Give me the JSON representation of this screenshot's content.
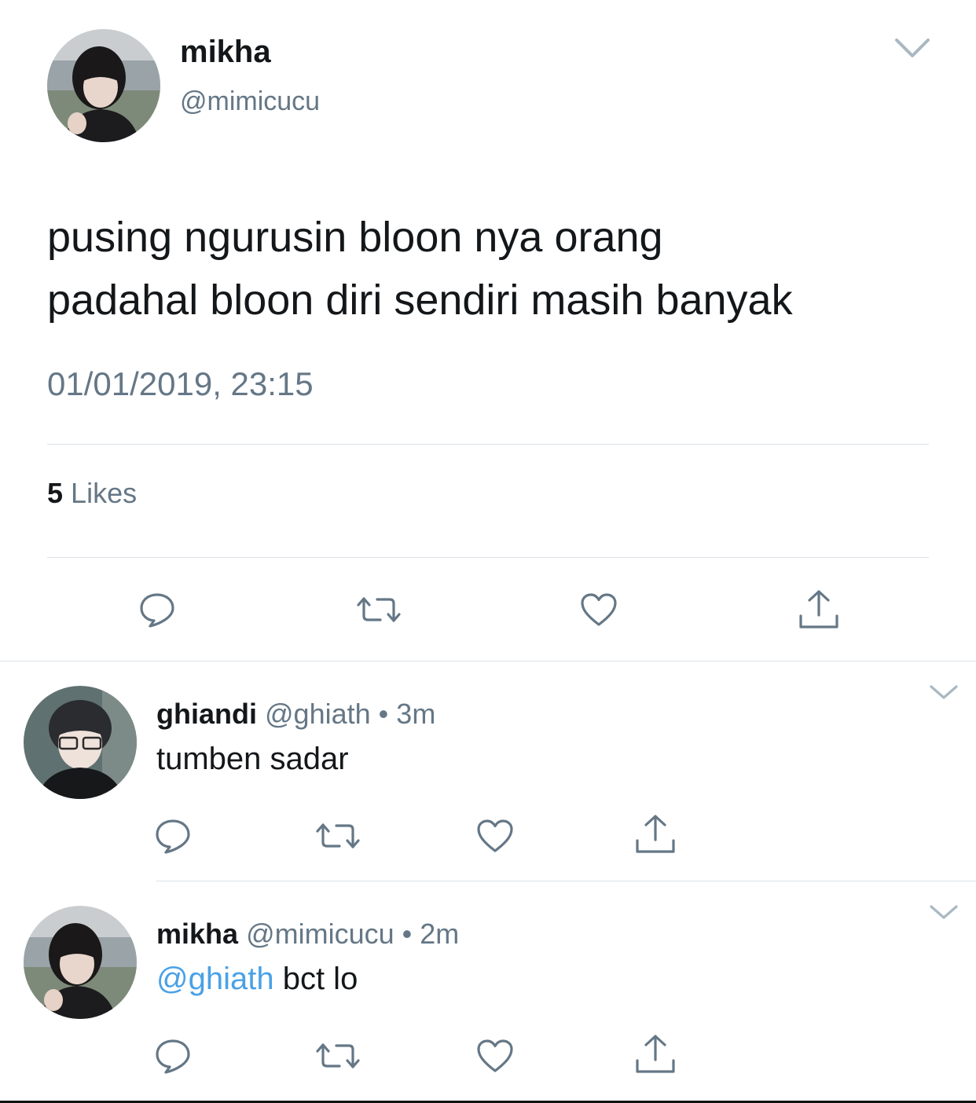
{
  "main_tweet": {
    "display_name": "mikha",
    "handle": "@mimicucu",
    "text_line1": "pusing ngurusin bloon nya orang",
    "text_line2": "padahal bloon diri sendiri masih banyak",
    "timestamp": "01/01/2019, 23:15",
    "likes_count": "5",
    "likes_label": "Likes",
    "actions": [
      "reply-icon",
      "retweet-icon",
      "heart-icon",
      "share-icon"
    ]
  },
  "replies": [
    {
      "display_name": "ghiandi",
      "handle": "@ghiath",
      "separator": "•",
      "time": "3m",
      "text": "tumben sadar"
    },
    {
      "display_name": "mikha",
      "handle": "@mimicucu",
      "separator": "•",
      "time": "2m",
      "mention": "@ghiath",
      "text": " bct lo"
    }
  ],
  "colors": {
    "text": "#14171a",
    "secondary": "#657786",
    "mention": "#4aa1e6",
    "divider": "#dde3e8"
  }
}
